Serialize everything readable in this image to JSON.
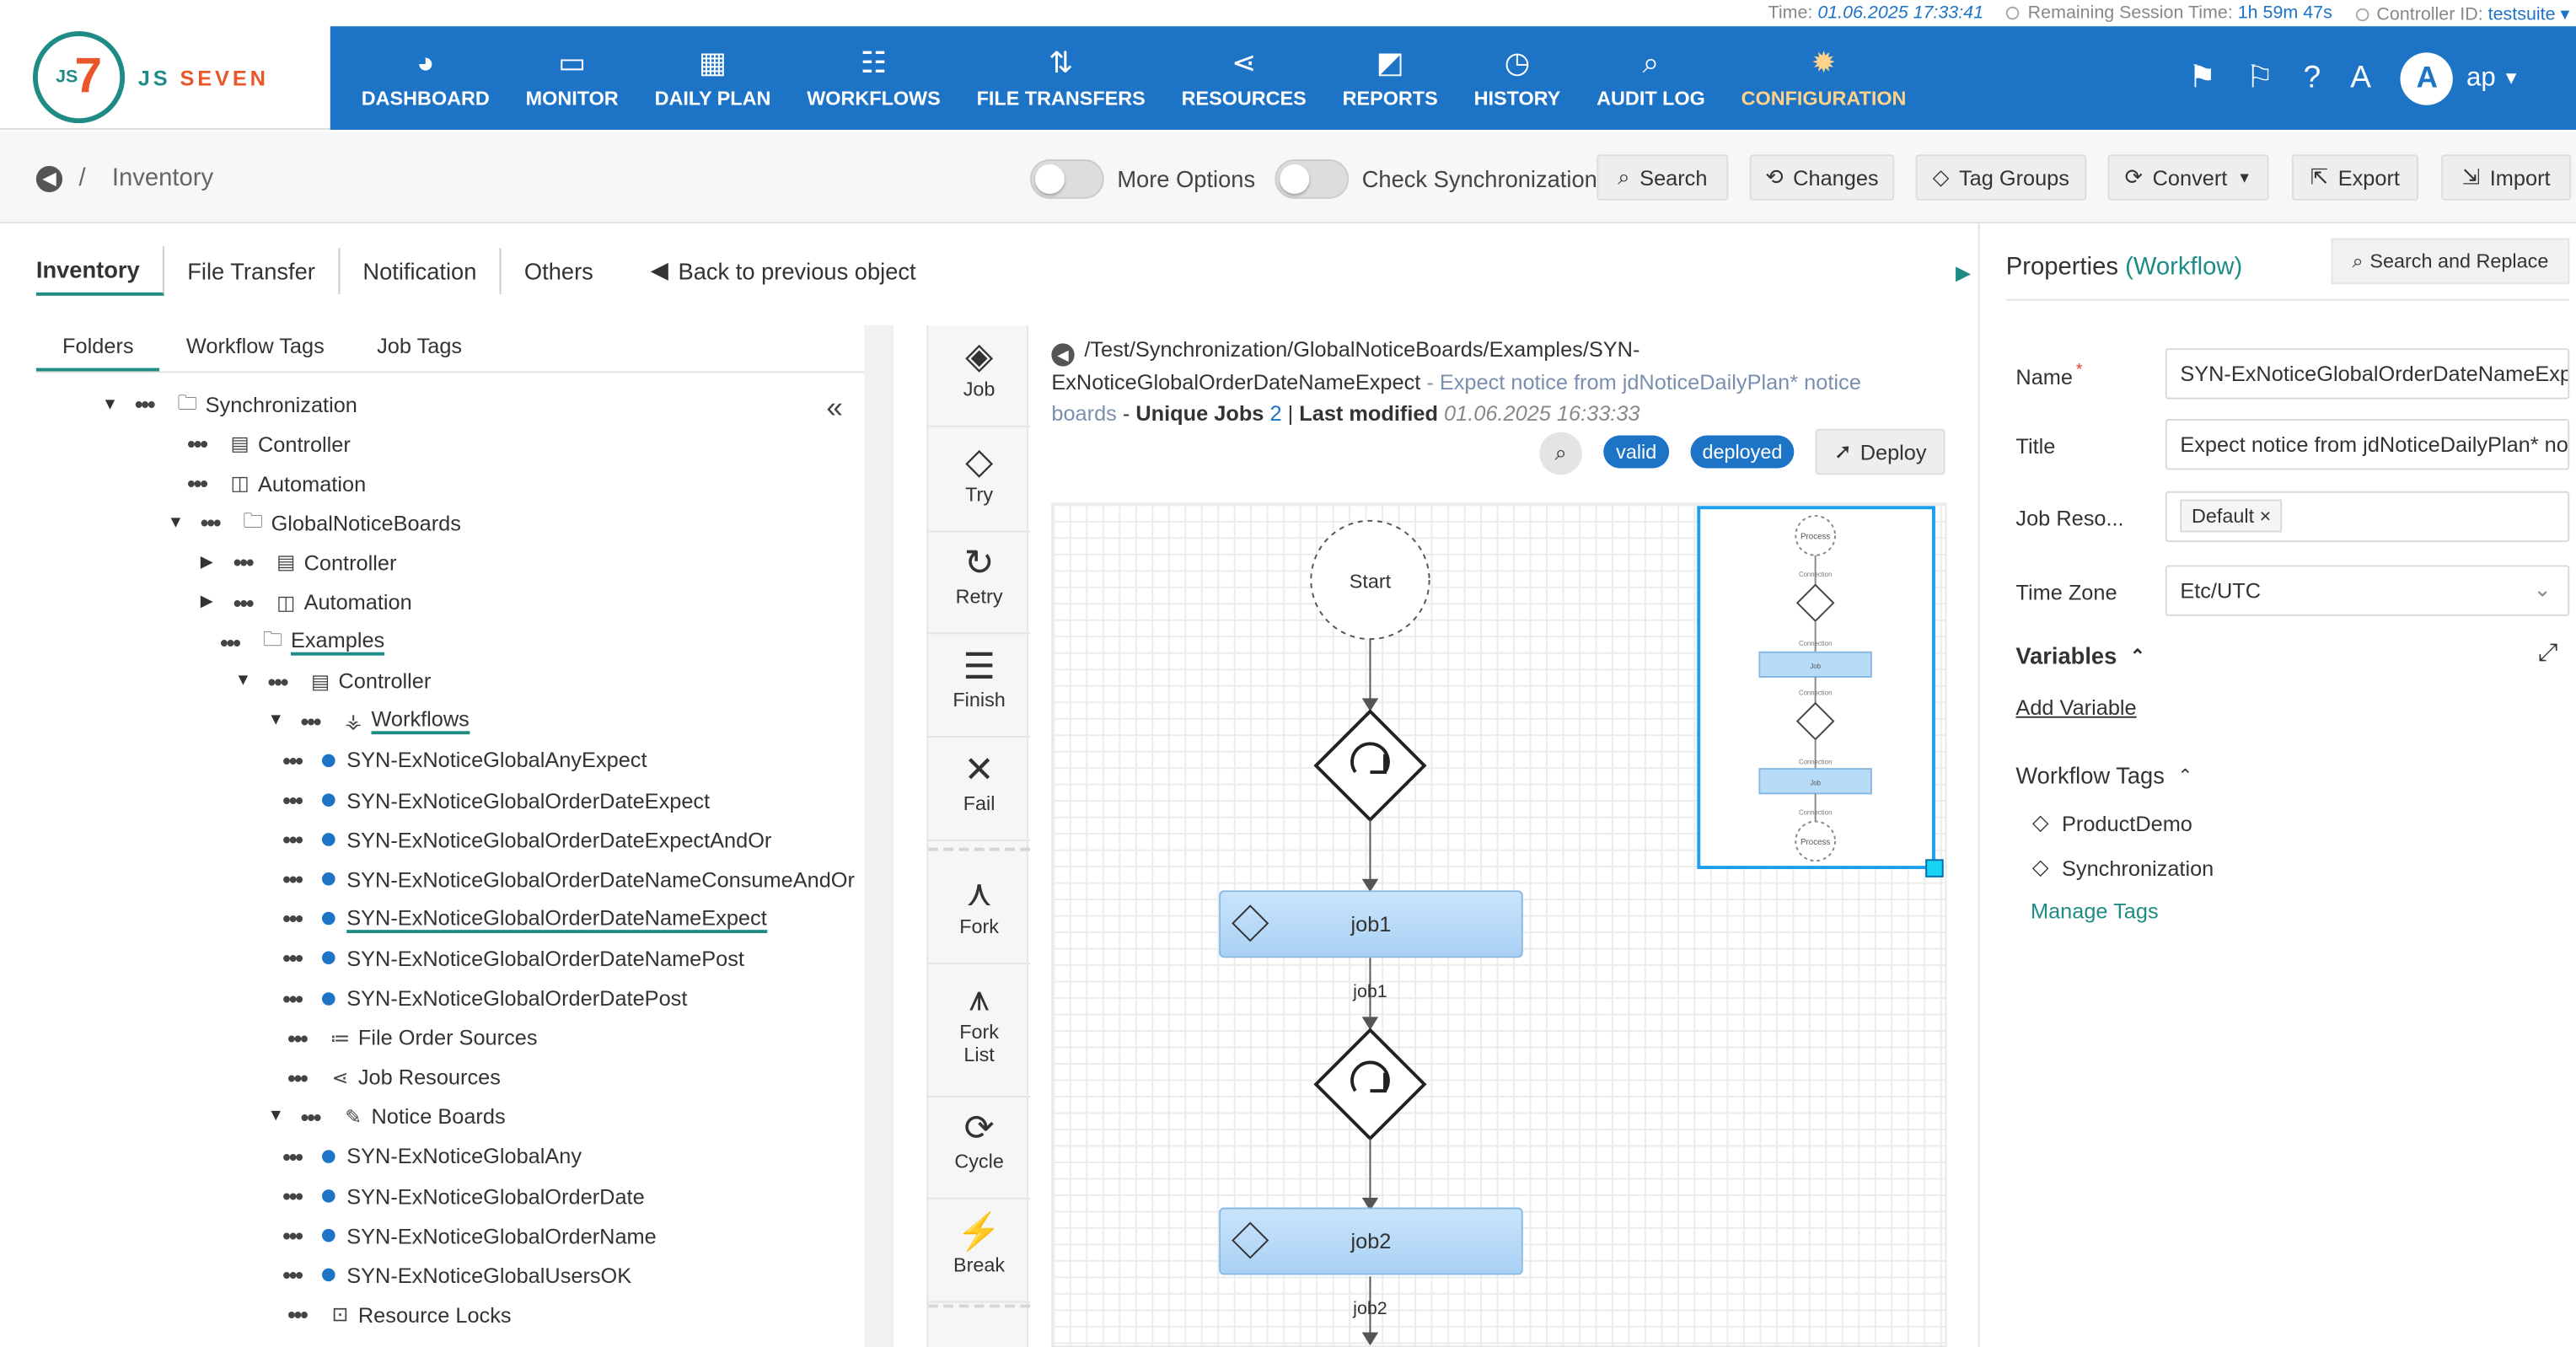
{
  "status": {
    "time_label": "Time:",
    "time_value": "01.06.2025 17:33:41",
    "session_label": "Remaining Session Time:",
    "session_value": "1h 59m 47s",
    "controller_label": "Controller ID:",
    "controller_value": "testsuite"
  },
  "logo": {
    "js": "JS",
    "seven": "7",
    "brand_a": "JS ",
    "brand_b": "SEVEN"
  },
  "nav": [
    {
      "label": "DASHBOARD",
      "icon": "dashboard-icon",
      "glyph": "◕"
    },
    {
      "label": "MONITOR",
      "icon": "monitor-icon",
      "glyph": "▭"
    },
    {
      "label": "DAILY PLAN",
      "icon": "calendar-icon",
      "glyph": "▦"
    },
    {
      "label": "WORKFLOWS",
      "icon": "workflow-icon",
      "glyph": "☷"
    },
    {
      "label": "FILE TRANSFERS",
      "icon": "transfer-icon",
      "glyph": "⇅"
    },
    {
      "label": "RESOURCES",
      "icon": "share-icon",
      "glyph": "⋖"
    },
    {
      "label": "REPORTS",
      "icon": "report-icon",
      "glyph": "◩"
    },
    {
      "label": "HISTORY",
      "icon": "clock-icon",
      "glyph": "◷"
    },
    {
      "label": "AUDIT LOG",
      "icon": "audit-icon",
      "glyph": "⌕"
    },
    {
      "label": "CONFIGURATION",
      "icon": "gear-icon",
      "glyph": "✹"
    }
  ],
  "user": {
    "initial": "A",
    "name": "ap"
  },
  "toolbar": {
    "breadcrumb_sep": "/",
    "breadcrumb": "Inventory",
    "more_options": "More Options",
    "check_sync": "Check Synchronization",
    "search": "Search",
    "changes": "Changes",
    "tag_groups": "Tag Groups",
    "convert": "Convert",
    "export": "Export",
    "import": "Import"
  },
  "tabs_main": [
    "Inventory",
    "File Transfer",
    "Notification",
    "Others"
  ],
  "back_prev": "Back to previous object",
  "tabs_tree": [
    "Folders",
    "Workflow Tags",
    "Job Tags"
  ],
  "tree": [
    {
      "label": "Synchronization",
      "level": 0,
      "caret": "open",
      "icon": "folder"
    },
    {
      "label": "Controller",
      "level": 1,
      "caret": "",
      "icon": "controller"
    },
    {
      "label": "Automation",
      "level": 1,
      "caret": "",
      "icon": "automation"
    },
    {
      "label": "GlobalNoticeBoards",
      "level": 1,
      "caret": "open",
      "icon": "folder"
    },
    {
      "label": "Controller",
      "level": 2,
      "caret": "closed",
      "icon": "controller"
    },
    {
      "label": "Automation",
      "level": 2,
      "caret": "closed",
      "icon": "automation"
    },
    {
      "label": "Examples",
      "level": 2,
      "caret": "",
      "icon": "folder",
      "underline": true
    },
    {
      "label": "Controller",
      "level": 3,
      "caret": "open",
      "icon": "controller"
    },
    {
      "label": "Workflows",
      "level": 4,
      "caret": "open",
      "icon": "workflow",
      "underline": true
    },
    {
      "label": "SYN-ExNoticeGlobalAnyExpect",
      "level": 5,
      "caret": "",
      "icon": "bullet"
    },
    {
      "label": "SYN-ExNoticeGlobalOrderDateExpect",
      "level": 5,
      "caret": "",
      "icon": "bullet"
    },
    {
      "label": "SYN-ExNoticeGlobalOrderDateExpectAndOr",
      "level": 5,
      "caret": "",
      "icon": "bullet"
    },
    {
      "label": "SYN-ExNoticeGlobalOrderDateNameConsumeAndOr",
      "level": 5,
      "caret": "",
      "icon": "bullet"
    },
    {
      "label": "SYN-ExNoticeGlobalOrderDateNameExpect",
      "level": 5,
      "caret": "",
      "icon": "bullet",
      "underline": true
    },
    {
      "label": "SYN-ExNoticeGlobalOrderDateNamePost",
      "level": 5,
      "caret": "",
      "icon": "bullet"
    },
    {
      "label": "SYN-ExNoticeGlobalOrderDatePost",
      "level": 5,
      "caret": "",
      "icon": "bullet"
    },
    {
      "label": "File Order Sources",
      "level": 4,
      "caret": "",
      "icon": "list"
    },
    {
      "label": "Job Resources",
      "level": 4,
      "caret": "",
      "icon": "share"
    },
    {
      "label": "Notice Boards",
      "level": 4,
      "caret": "open",
      "icon": "pin"
    },
    {
      "label": "SYN-ExNoticeGlobalAny",
      "level": 5,
      "caret": "",
      "icon": "bullet"
    },
    {
      "label": "SYN-ExNoticeGlobalOrderDate",
      "level": 5,
      "caret": "",
      "icon": "bullet"
    },
    {
      "label": "SYN-ExNoticeGlobalOrderName",
      "level": 5,
      "caret": "",
      "icon": "bullet"
    },
    {
      "label": "SYN-ExNoticeGlobalUsersOK",
      "level": 5,
      "caret": "",
      "icon": "bullet"
    },
    {
      "label": "Resource Locks",
      "level": 4,
      "caret": "",
      "icon": "lock"
    }
  ],
  "palette": [
    {
      "label": "Job",
      "icon": "job-icon",
      "glyph": "◈"
    },
    {
      "label": "Try",
      "icon": "try-icon",
      "glyph": "◇"
    },
    {
      "label": "Retry",
      "icon": "retry-icon",
      "glyph": "↻"
    },
    {
      "label": "Finish",
      "icon": "finish-icon",
      "glyph": "☰"
    },
    {
      "label": "Fail",
      "icon": "fail-icon",
      "glyph": "✕"
    },
    {
      "label": "Fork",
      "icon": "fork-icon",
      "glyph": "⋏"
    },
    {
      "label": "Fork\nList",
      "icon": "fork-list-icon",
      "glyph": "⩚"
    },
    {
      "label": "Cycle",
      "icon": "cycle-icon",
      "glyph": "⟳"
    },
    {
      "label": "Break",
      "icon": "break-icon",
      "glyph": "⚡"
    }
  ],
  "workflow": {
    "path": "/Test/Synchronization/GlobalNoticeBoards/Examples/SYN-ExNoticeGlobalOrderDateNameExpect",
    "title_suffix": " - Expect notice from jdNoticeDailyPlan* notice boards",
    "unique_jobs_label": "Unique Jobs",
    "unique_jobs_value": "2",
    "last_modified_label": "Last modified",
    "last_modified_value": "01.06.2025 16:33:33",
    "valid": "valid",
    "deployed": "deployed",
    "deploy": "Deploy"
  },
  "graph": {
    "start": "Start",
    "job1": "job1",
    "job1_edge": "job1",
    "job2": "job2",
    "job2_edge": "job2"
  },
  "minimap": {
    "process": "Process",
    "connection": "Connection",
    "job": "Job"
  },
  "properties": {
    "title": "Properties",
    "type": "(Workflow)",
    "search_replace": "Search and Replace",
    "name_label": "Name",
    "name_value": "SYN-ExNoticeGlobalOrderDateNameExpect",
    "title_label": "Title",
    "title_value": "Expect notice from jdNoticeDailyPlan* notice boards",
    "job_resources_label": "Job Reso...",
    "job_resources_value": "Default",
    "timezone_label": "Time Zone",
    "timezone_value": "Etc/UTC",
    "variables_label": "Variables",
    "add_variable": "Add Variable",
    "workflow_tags_label": "Workflow Tags",
    "tags": [
      "ProductDemo",
      "Synchronization"
    ],
    "manage_tags": "Manage Tags"
  }
}
